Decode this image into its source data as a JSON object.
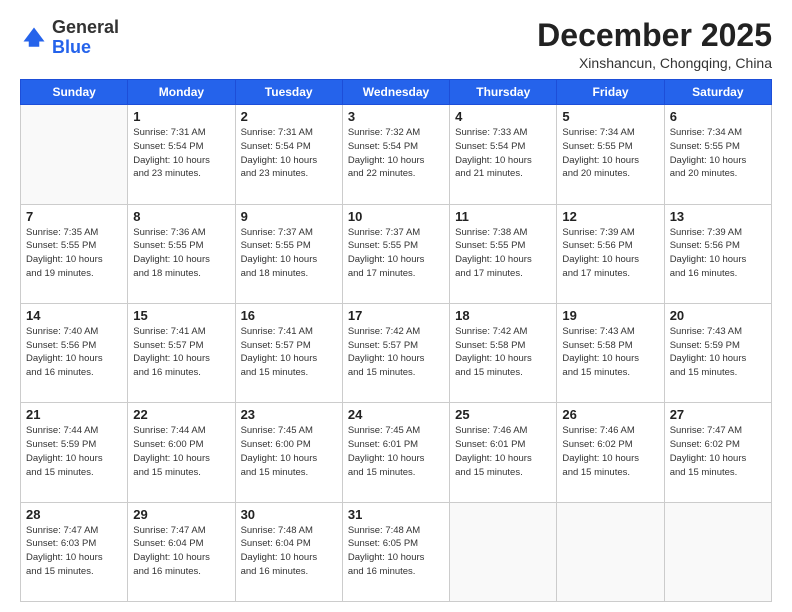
{
  "logo": {
    "general": "General",
    "blue": "Blue"
  },
  "header": {
    "title": "December 2025",
    "subtitle": "Xinshancun, Chongqing, China"
  },
  "weekdays": [
    "Sunday",
    "Monday",
    "Tuesday",
    "Wednesday",
    "Thursday",
    "Friday",
    "Saturday"
  ],
  "weeks": [
    [
      {
        "day": "",
        "info": ""
      },
      {
        "day": "1",
        "info": "Sunrise: 7:31 AM\nSunset: 5:54 PM\nDaylight: 10 hours\nand 23 minutes."
      },
      {
        "day": "2",
        "info": "Sunrise: 7:31 AM\nSunset: 5:54 PM\nDaylight: 10 hours\nand 23 minutes."
      },
      {
        "day": "3",
        "info": "Sunrise: 7:32 AM\nSunset: 5:54 PM\nDaylight: 10 hours\nand 22 minutes."
      },
      {
        "day": "4",
        "info": "Sunrise: 7:33 AM\nSunset: 5:54 PM\nDaylight: 10 hours\nand 21 minutes."
      },
      {
        "day": "5",
        "info": "Sunrise: 7:34 AM\nSunset: 5:55 PM\nDaylight: 10 hours\nand 20 minutes."
      },
      {
        "day": "6",
        "info": "Sunrise: 7:34 AM\nSunset: 5:55 PM\nDaylight: 10 hours\nand 20 minutes."
      }
    ],
    [
      {
        "day": "7",
        "info": "Sunrise: 7:35 AM\nSunset: 5:55 PM\nDaylight: 10 hours\nand 19 minutes."
      },
      {
        "day": "8",
        "info": "Sunrise: 7:36 AM\nSunset: 5:55 PM\nDaylight: 10 hours\nand 18 minutes."
      },
      {
        "day": "9",
        "info": "Sunrise: 7:37 AM\nSunset: 5:55 PM\nDaylight: 10 hours\nand 18 minutes."
      },
      {
        "day": "10",
        "info": "Sunrise: 7:37 AM\nSunset: 5:55 PM\nDaylight: 10 hours\nand 17 minutes."
      },
      {
        "day": "11",
        "info": "Sunrise: 7:38 AM\nSunset: 5:55 PM\nDaylight: 10 hours\nand 17 minutes."
      },
      {
        "day": "12",
        "info": "Sunrise: 7:39 AM\nSunset: 5:56 PM\nDaylight: 10 hours\nand 17 minutes."
      },
      {
        "day": "13",
        "info": "Sunrise: 7:39 AM\nSunset: 5:56 PM\nDaylight: 10 hours\nand 16 minutes."
      }
    ],
    [
      {
        "day": "14",
        "info": "Sunrise: 7:40 AM\nSunset: 5:56 PM\nDaylight: 10 hours\nand 16 minutes."
      },
      {
        "day": "15",
        "info": "Sunrise: 7:41 AM\nSunset: 5:57 PM\nDaylight: 10 hours\nand 16 minutes."
      },
      {
        "day": "16",
        "info": "Sunrise: 7:41 AM\nSunset: 5:57 PM\nDaylight: 10 hours\nand 15 minutes."
      },
      {
        "day": "17",
        "info": "Sunrise: 7:42 AM\nSunset: 5:57 PM\nDaylight: 10 hours\nand 15 minutes."
      },
      {
        "day": "18",
        "info": "Sunrise: 7:42 AM\nSunset: 5:58 PM\nDaylight: 10 hours\nand 15 minutes."
      },
      {
        "day": "19",
        "info": "Sunrise: 7:43 AM\nSunset: 5:58 PM\nDaylight: 10 hours\nand 15 minutes."
      },
      {
        "day": "20",
        "info": "Sunrise: 7:43 AM\nSunset: 5:59 PM\nDaylight: 10 hours\nand 15 minutes."
      }
    ],
    [
      {
        "day": "21",
        "info": "Sunrise: 7:44 AM\nSunset: 5:59 PM\nDaylight: 10 hours\nand 15 minutes."
      },
      {
        "day": "22",
        "info": "Sunrise: 7:44 AM\nSunset: 6:00 PM\nDaylight: 10 hours\nand 15 minutes."
      },
      {
        "day": "23",
        "info": "Sunrise: 7:45 AM\nSunset: 6:00 PM\nDaylight: 10 hours\nand 15 minutes."
      },
      {
        "day": "24",
        "info": "Sunrise: 7:45 AM\nSunset: 6:01 PM\nDaylight: 10 hours\nand 15 minutes."
      },
      {
        "day": "25",
        "info": "Sunrise: 7:46 AM\nSunset: 6:01 PM\nDaylight: 10 hours\nand 15 minutes."
      },
      {
        "day": "26",
        "info": "Sunrise: 7:46 AM\nSunset: 6:02 PM\nDaylight: 10 hours\nand 15 minutes."
      },
      {
        "day": "27",
        "info": "Sunrise: 7:47 AM\nSunset: 6:02 PM\nDaylight: 10 hours\nand 15 minutes."
      }
    ],
    [
      {
        "day": "28",
        "info": "Sunrise: 7:47 AM\nSunset: 6:03 PM\nDaylight: 10 hours\nand 15 minutes."
      },
      {
        "day": "29",
        "info": "Sunrise: 7:47 AM\nSunset: 6:04 PM\nDaylight: 10 hours\nand 16 minutes."
      },
      {
        "day": "30",
        "info": "Sunrise: 7:48 AM\nSunset: 6:04 PM\nDaylight: 10 hours\nand 16 minutes."
      },
      {
        "day": "31",
        "info": "Sunrise: 7:48 AM\nSunset: 6:05 PM\nDaylight: 10 hours\nand 16 minutes."
      },
      {
        "day": "",
        "info": ""
      },
      {
        "day": "",
        "info": ""
      },
      {
        "day": "",
        "info": ""
      }
    ]
  ]
}
